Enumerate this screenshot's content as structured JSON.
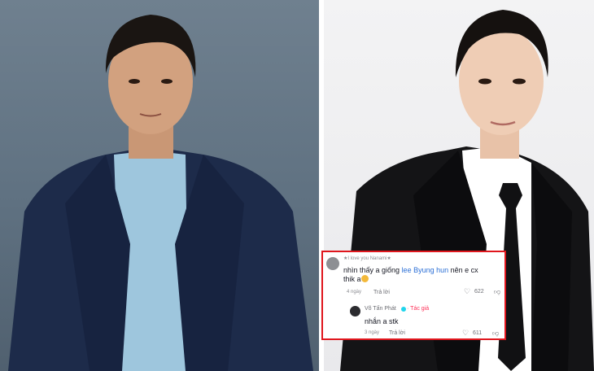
{
  "comment_thread": {
    "comment": {
      "username": "★I love you Nanami★",
      "text_before_mention": "nhìn thấy a giống ",
      "mention": "lee Byung hun",
      "text_after_mention": " nên e cx thik a",
      "time": "4 ngày",
      "reply_label": "Trả lời",
      "likes": "622"
    },
    "reply": {
      "username": "Võ Tấn Phát",
      "author_badge": "· Tác giả",
      "text": "nhắn a stk",
      "time": "3 ngày",
      "reply_label": "Trả lời",
      "likes": "611"
    }
  },
  "colors": {
    "highlight_border": "#e0161d",
    "mention": "#2b6fd6",
    "author_badge": "#fe2c55"
  }
}
